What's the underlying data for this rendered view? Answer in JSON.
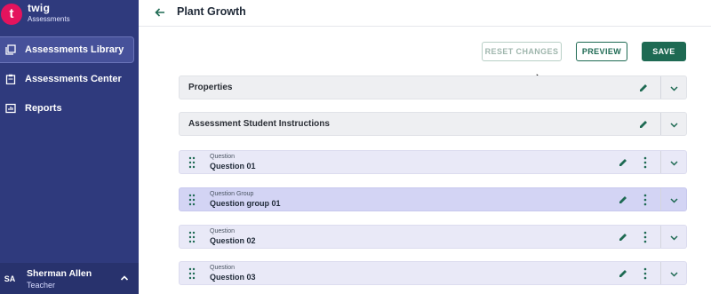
{
  "brand": {
    "logo_letter": "t",
    "name": "twig",
    "subtitle": "Assessments"
  },
  "nav": [
    {
      "label": "Assessments Library",
      "icon": "library-icon",
      "active": true
    },
    {
      "label": "Assessments Center",
      "icon": "clipboard-icon",
      "active": false
    },
    {
      "label": "Reports",
      "icon": "chart-icon",
      "active": false
    }
  ],
  "user": {
    "initials": "SA",
    "name": "Sherman Allen",
    "role": "Teacher"
  },
  "header": {
    "title": "Plant Growth"
  },
  "actions": {
    "reset": "RESET CHANGES",
    "preview": "PREVIEW",
    "save": "SAVE"
  },
  "sections": [
    {
      "title": "Properties"
    },
    {
      "title": "Assessment Student Instructions"
    }
  ],
  "items": [
    {
      "type": "Question",
      "name": "Question 01"
    },
    {
      "type": "Question Group",
      "name": "Question group 01"
    },
    {
      "type": "Question",
      "name": "Question 02"
    },
    {
      "type": "Question",
      "name": "Question 03"
    }
  ],
  "colors": {
    "sidebar": "#2f3a7d",
    "accent": "#1e6a53",
    "logo": "#e4135d",
    "group_row": "#d3d4f4"
  }
}
